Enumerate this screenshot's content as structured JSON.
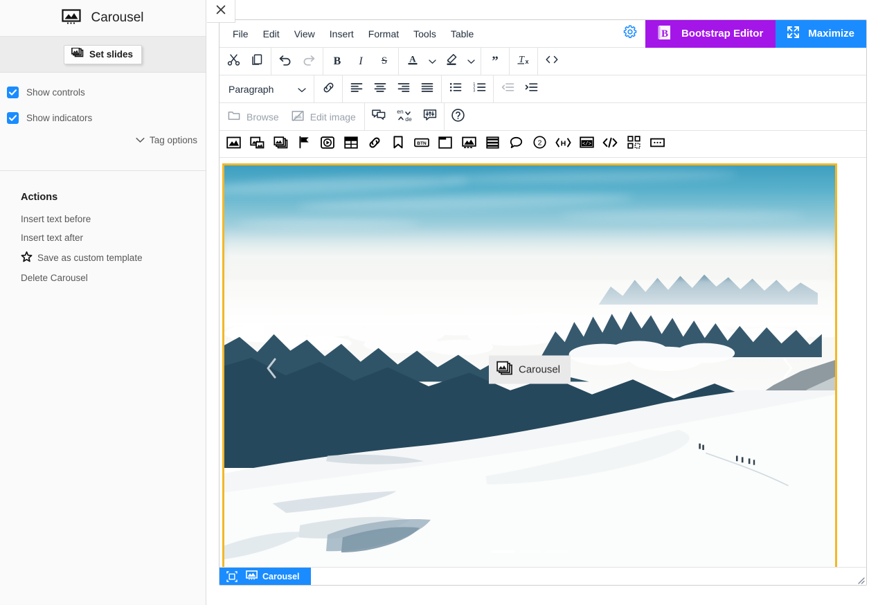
{
  "sidebar": {
    "title": "Carousel",
    "title_icon": "carousel-image-icon",
    "set_slides_label": "Set slides",
    "set_slides_icon": "slides-stack-icon",
    "checkboxes": [
      {
        "label": "Show controls",
        "checked": true
      },
      {
        "label": "Show indicators",
        "checked": true
      }
    ],
    "tag_options_label": "Tag options",
    "tag_options_icon": "chevron-down-icon",
    "actions_heading": "Actions",
    "actions": [
      {
        "label": "Insert text before",
        "icon": ""
      },
      {
        "label": "Insert text after",
        "icon": ""
      },
      {
        "label": "Save as custom template",
        "icon": "star-icon"
      },
      {
        "label": "Delete Carousel",
        "icon": ""
      }
    ],
    "close_label": "×",
    "close_icon": "close-icon"
  },
  "editor": {
    "menus": [
      "File",
      "Edit",
      "View",
      "Insert",
      "Format",
      "Tools",
      "Table"
    ],
    "gear_icon": "gear-icon",
    "gear_color": "#1a8cff",
    "bootstrap_button": {
      "label": "Bootstrap Editor",
      "icon": "bootstrap-b-icon",
      "color": "#a416e8"
    },
    "maximize_button": {
      "label": "Maximize",
      "icon": "maximize-arrows-icon",
      "color": "#1a8cff"
    },
    "toolbar_row1": [
      {
        "name": "cut-button",
        "icon": "scissors-icon",
        "disabled": false
      },
      {
        "name": "copy-button",
        "icon": "copy-icon",
        "disabled": false
      },
      {
        "name": "undo-button",
        "icon": "undo-arrow-icon",
        "disabled": false
      },
      {
        "name": "redo-button",
        "icon": "redo-arrow-icon",
        "disabled": true
      },
      {
        "name": "bold-button",
        "icon": "bold-b-icon",
        "disabled": false
      },
      {
        "name": "italic-button",
        "icon": "italic-i-icon",
        "disabled": false
      },
      {
        "name": "strikethrough-button",
        "icon": "strikethrough-s-icon",
        "disabled": false
      },
      {
        "name": "text-color-button",
        "icon": "text-color-a-icon",
        "disabled": false
      },
      {
        "name": "text-color-dropdown",
        "icon": "chevron-down-icon",
        "disabled": false
      },
      {
        "name": "highlight-color-button",
        "icon": "highlighter-pen-icon",
        "disabled": false
      },
      {
        "name": "highlight-color-dropdown",
        "icon": "chevron-down-icon",
        "disabled": false
      },
      {
        "name": "blockquote-button",
        "icon": "quote-marks-icon",
        "disabled": false
      },
      {
        "name": "clear-formatting-button",
        "icon": "tx-clear-format-icon",
        "disabled": false
      },
      {
        "name": "source-code-button",
        "icon": "angle-brackets-icon",
        "disabled": false
      }
    ],
    "block_format": {
      "value": "Paragraph",
      "caret_icon": "chevron-down-icon"
    },
    "toolbar_row2": [
      {
        "name": "insert-link-button",
        "icon": "chain-link-icon",
        "disabled": false
      },
      {
        "name": "align-left-button",
        "icon": "align-left-icon",
        "disabled": false
      },
      {
        "name": "align-center-button",
        "icon": "align-center-icon",
        "disabled": false
      },
      {
        "name": "align-right-button",
        "icon": "align-right-icon",
        "disabled": false
      },
      {
        "name": "align-justify-button",
        "icon": "align-justify-icon",
        "disabled": false
      },
      {
        "name": "bullet-list-button",
        "icon": "bullet-list-icon",
        "disabled": false
      },
      {
        "name": "numbered-list-button",
        "icon": "numbered-list-icon",
        "disabled": false
      },
      {
        "name": "outdent-button",
        "icon": "outdent-icon",
        "disabled": true
      },
      {
        "name": "indent-button",
        "icon": "indent-icon",
        "disabled": false
      }
    ],
    "toolbar_row3": {
      "browse_label": "Browse",
      "browse_icon": "folder-open-icon",
      "edit_image_label": "Edit image",
      "edit_image_icon": "image-edit-icon",
      "buttons": [
        {
          "name": "comments-button",
          "icon": "speech-bubbles-icon"
        },
        {
          "name": "translate-button",
          "icon": "en-de-translate-icon",
          "top_text": "en",
          "bottom_text": "de"
        },
        {
          "name": "tone-settings-button",
          "icon": "bubble-sliders-icon"
        },
        {
          "name": "help-button",
          "icon": "question-circle-icon"
        }
      ]
    },
    "toolbar_row4": [
      {
        "name": "insert-image-button",
        "icon": "picture-icon"
      },
      {
        "name": "insert-figure-button",
        "icon": "figure-image-icon"
      },
      {
        "name": "insert-carousel-button",
        "icon": "slides-stack-icon"
      },
      {
        "name": "insert-flag-button",
        "icon": "flag-icon"
      },
      {
        "name": "insert-video-button",
        "icon": "play-circle-icon"
      },
      {
        "name": "insert-table-button",
        "icon": "table-grid-icon"
      },
      {
        "name": "insert-link2-button",
        "icon": "chain-link-icon"
      },
      {
        "name": "insert-bookmark-button",
        "icon": "bookmark-icon"
      },
      {
        "name": "insert-button-element",
        "icon": "btn-label-icon",
        "text": "BTN"
      },
      {
        "name": "insert-card-button",
        "icon": "card-window-icon"
      },
      {
        "name": "insert-media-object-button",
        "icon": "media-object-icon"
      },
      {
        "name": "insert-list-group-button",
        "icon": "list-group-icon"
      },
      {
        "name": "insert-tooltip-button",
        "icon": "speech-bubble-icon"
      },
      {
        "name": "insert-badge-button",
        "icon": "circle-two-icon",
        "text": "2"
      },
      {
        "name": "insert-anchor-button",
        "icon": "angle-h-icon",
        "text": "H"
      },
      {
        "name": "insert-embed-button",
        "icon": "embed-window-icon"
      },
      {
        "name": "insert-code-button",
        "icon": "code-slash-icon"
      },
      {
        "name": "insert-qr-button",
        "icon": "qr-code-icon"
      },
      {
        "name": "insert-more-button",
        "icon": "ellipsis-box-icon"
      }
    ]
  },
  "carousel": {
    "border_color": "#f2b827",
    "badge_label": "Carousel",
    "badge_icon": "slides-stack-icon",
    "prev_icon": "chevron-left-icon",
    "next_icon": "chevron-right-icon",
    "indicators": [
      {
        "active": true
      },
      {
        "active": false
      },
      {
        "active": false
      }
    ]
  },
  "statusbar": {
    "path_icon": "element-selection-icon",
    "element_icon": "picture-icon",
    "element_label": "Carousel",
    "accent_color": "#1a8cff",
    "resize_icon": "resize-grip-icon"
  }
}
